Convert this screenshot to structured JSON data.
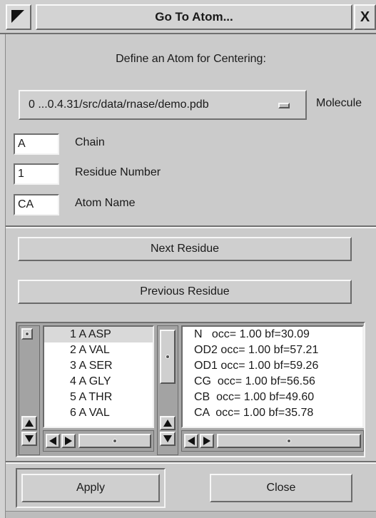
{
  "window": {
    "title": "Go To Atom...",
    "close_glyph": "X"
  },
  "heading": "Define an Atom for Centering:",
  "molecule": {
    "selected": "0 ...0.4.31/src/data/rnase/demo.pdb",
    "label": "Molecule"
  },
  "fields": [
    {
      "value": "A",
      "label": "Chain"
    },
    {
      "value": "1",
      "label": "Residue Number"
    },
    {
      "value": "CA",
      "label": "Atom Name"
    }
  ],
  "buttons": {
    "next_residue": "Next Residue",
    "previous_residue": "Previous Residue",
    "apply": "Apply",
    "close": "Close"
  },
  "residues": [
    "1 A ASP",
    "2 A VAL",
    "3 A SER",
    "4 A GLY",
    "5 A THR",
    "6 A VAL"
  ],
  "selected_residue_index": 0,
  "atoms": [
    "N   occ= 1.00 bf=30.09",
    "OD2 occ= 1.00 bf=57.21",
    "OD1 occ= 1.00 bf=59.26",
    "CG  occ= 1.00 bf=56.56",
    "CB  occ= 1.00 bf=49.60",
    "CA  occ= 1.00 bf=35.78"
  ],
  "colors": {
    "window_bg": "#cbcbcb",
    "list_bg": "#ffffff",
    "selected_row": "#d9d9d9"
  }
}
